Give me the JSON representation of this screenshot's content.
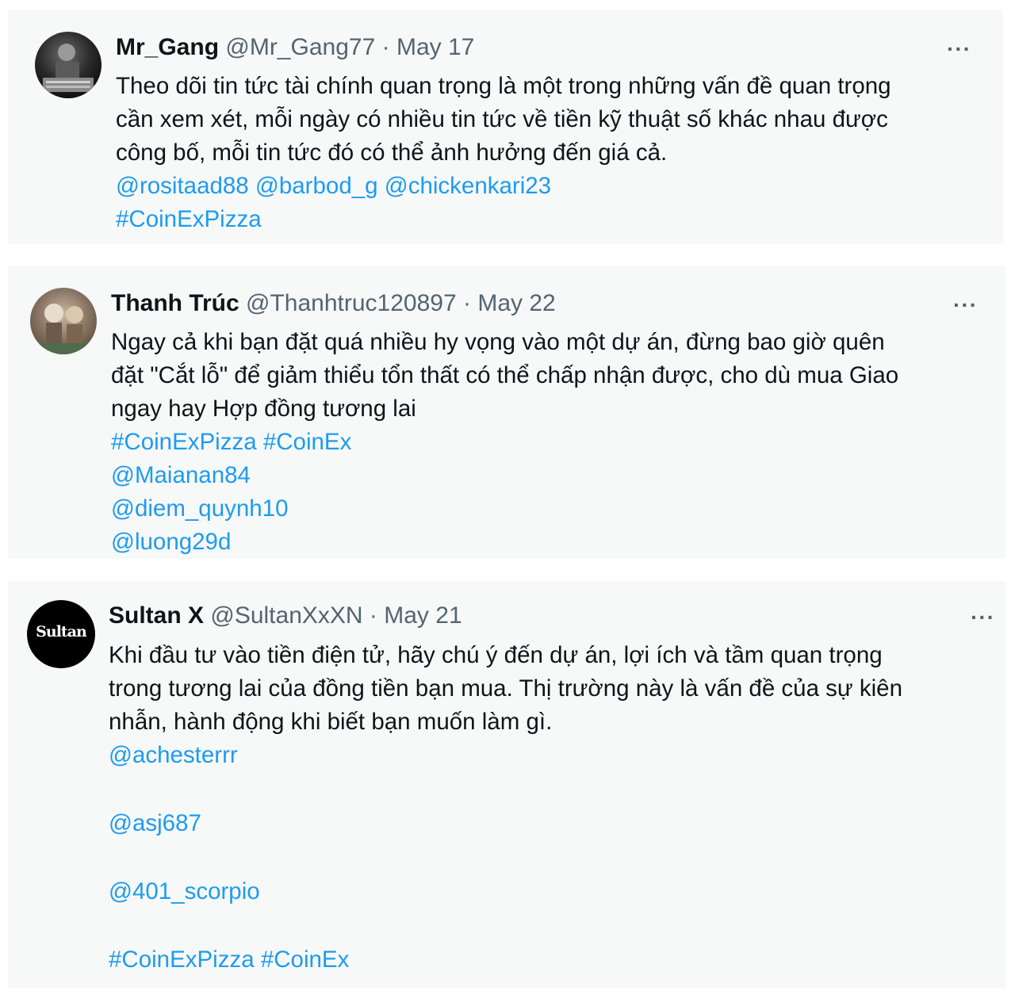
{
  "tweets": [
    {
      "display_name": "Mr_Gang",
      "handle": "@Mr_Gang77",
      "sep": "·",
      "date": "May 17",
      "more": "···",
      "text": [
        "Theo dõi tin tức tài chính quan trọng là một trong những vấn đề quan trọng",
        "cần xem xét, mỗi ngày có nhiều tin tức về tiền kỹ thuật số khác nhau được",
        "công bố, mỗi tin tức đó có thể ảnh hưởng đến giá cả."
      ],
      "mentions": [
        "@rositaad88",
        "@barbod_g",
        "@chickenkari23"
      ],
      "hashtags": [
        "#CoinExPizza"
      ]
    },
    {
      "display_name": "Thanh Trúc",
      "handle": "@Thanhtruc120897",
      "sep": "·",
      "date": "May 22",
      "more": "···",
      "text": [
        "Ngay cả khi bạn đặt quá nhiều hy vọng vào một dự án, đừng bao giờ quên",
        "đặt \"Cắt lỗ\" để giảm thiểu tổn thất có thể chấp nhận được, cho dù mua Giao",
        "ngay hay Hợp đồng tương lai"
      ],
      "hashtags": [
        "#CoinExPizza",
        "#CoinEx"
      ],
      "mentions": [
        "@Maianan84",
        "@diem_quynh10",
        "@luong29d"
      ]
    },
    {
      "display_name": "Sultan X",
      "handle": "@SultanXxXN",
      "sep": "·",
      "date": "May 21",
      "more": "···",
      "avatar_text": "Sultan",
      "text": [
        "Khi đầu tư vào tiền điện tử, hãy chú ý đến dự án, lợi ích và tầm quan trọng",
        "trong tương lai của đồng tiền bạn mua.  Thị trường này là vấn đề của sự kiên",
        "nhẫn, hành động khi biết bạn muốn làm gì."
      ],
      "mentions": [
        "@achesterrr",
        "@asj687",
        "@401_scorpio"
      ],
      "hashtags": [
        "#CoinExPizza",
        "#CoinEx"
      ]
    }
  ],
  "colors": {
    "link": "#1d9bf0",
    "muted": "#536471",
    "card_bg": "#f7f9f9",
    "text": "#0f1419"
  }
}
